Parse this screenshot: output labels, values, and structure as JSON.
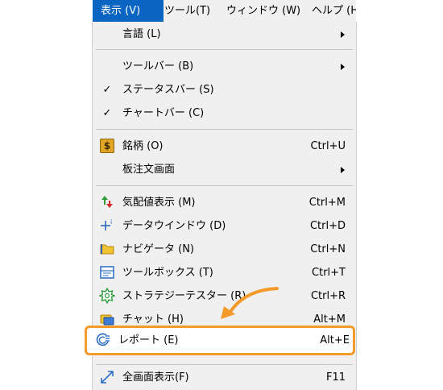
{
  "menubar": {
    "items": [
      {
        "label": "表示 (V)",
        "active": true
      },
      {
        "label": "ツール(T)",
        "active": false
      },
      {
        "label": "ウィンドウ (W)",
        "active": false
      },
      {
        "label": "ヘルプ (H",
        "active": false
      }
    ]
  },
  "menu": {
    "language": {
      "label": "言語 (L)"
    },
    "toolbar": {
      "label": "ツールバー (B)"
    },
    "statusbar": {
      "label": "ステータスバー (S)",
      "check": "✓"
    },
    "chartbar": {
      "label": "チャートバー (C)",
      "check": "✓"
    },
    "symbol": {
      "label": "銘柄 (O)",
      "shortcut": "Ctrl+U",
      "icon_text": "$"
    },
    "depth": {
      "label": "板注文画面"
    },
    "market_watch": {
      "label": "気配値表示 (M)",
      "shortcut": "Ctrl+M"
    },
    "data_window": {
      "label": "データウインドウ (D)",
      "shortcut": "Ctrl+D"
    },
    "navigator": {
      "label": "ナビゲータ (N)",
      "shortcut": "Ctrl+N"
    },
    "toolbox": {
      "label": "ツールボックス (T)",
      "shortcut": "Ctrl+T"
    },
    "strategy_tester": {
      "label": "ストラテジーテスター (R)",
      "shortcut": "Ctrl+R"
    },
    "chat": {
      "label": "チャット (H)",
      "shortcut": "Alt+M"
    },
    "report": {
      "label": "レポート (E)",
      "shortcut": "Alt+E"
    },
    "fullscreen": {
      "label": "全画面表示(F)",
      "shortcut": "F11"
    }
  },
  "colors": {
    "menubar_active": "#0a64c2",
    "menu_background": "#f0f0f0",
    "highlight_border": "#f39a2b"
  }
}
